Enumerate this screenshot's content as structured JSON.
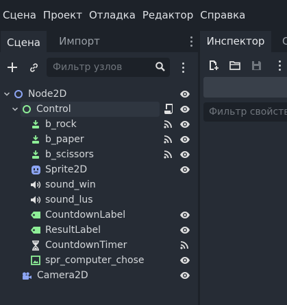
{
  "menubar": {
    "items": [
      "Сцена",
      "Проект",
      "Отладка",
      "Редактор",
      "Справка"
    ]
  },
  "scene_dock": {
    "tabs": [
      {
        "label": "Сцена",
        "active": true
      },
      {
        "label": "Импорт",
        "active": false
      }
    ],
    "filter_placeholder": "Фильтр узлов",
    "tree": [
      {
        "label": "Node2D",
        "icon": "node2d-icon",
        "depth": 0,
        "expanded": true,
        "visible_toggle": true
      },
      {
        "label": "Control",
        "icon": "control-icon",
        "depth": 1,
        "expanded": true,
        "selected": true,
        "script": true,
        "visible_toggle": true
      },
      {
        "label": "b_rock",
        "icon": "texture-button-icon",
        "depth": 2,
        "signals": true,
        "visible_toggle": true
      },
      {
        "label": "b_paper",
        "icon": "texture-button-icon",
        "depth": 2,
        "signals": true,
        "visible_toggle": true
      },
      {
        "label": "b_scissors",
        "icon": "texture-button-icon",
        "depth": 2,
        "signals": true,
        "visible_toggle": true
      },
      {
        "label": "Sprite2D",
        "icon": "sprite2d-icon",
        "depth": 2,
        "visible_toggle": true
      },
      {
        "label": "sound_win",
        "icon": "audio-stream-player-icon",
        "depth": 2
      },
      {
        "label": "sound_lus",
        "icon": "audio-stream-player-icon",
        "depth": 2
      },
      {
        "label": "CountdownLabel",
        "icon": "label-icon",
        "depth": 2,
        "visible_toggle": true
      },
      {
        "label": "ResultLabel",
        "icon": "label-icon",
        "depth": 2,
        "visible_toggle": true
      },
      {
        "label": "CountdownTimer",
        "icon": "timer-icon",
        "depth": 2,
        "signals": true
      },
      {
        "label": "spr_computer_chose",
        "icon": "texture-rect-icon",
        "depth": 2,
        "visible_toggle": true
      },
      {
        "label": "Camera2D",
        "icon": "camera2d-icon",
        "depth": 1,
        "visible_toggle": true
      }
    ]
  },
  "inspector_dock": {
    "tabs": [
      {
        "label": "Инспектор",
        "active": true
      },
      {
        "label": "С",
        "active": false
      }
    ],
    "filter_placeholder": "Фильтр свойств"
  },
  "colors": {
    "background": "#1d2229",
    "panel": "#262c35",
    "node2d_blue": "#8da5f3",
    "control_green": "#8eef97",
    "accent_light": "#e0e0e0"
  }
}
